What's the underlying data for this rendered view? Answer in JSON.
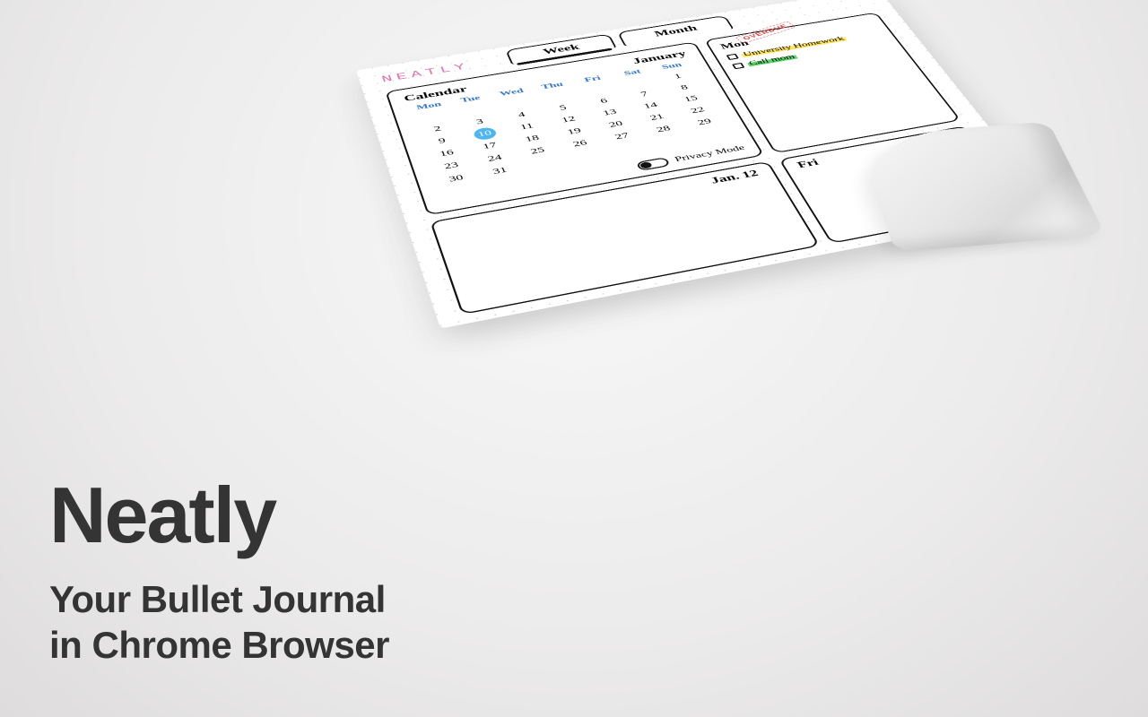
{
  "marketing": {
    "title": "Neatly",
    "subtitle_line1": "Your Bullet Journal",
    "subtitle_line2": "in Chrome Browser"
  },
  "logo": "NEATLY",
  "tabs": {
    "week": "Week",
    "month": "Month"
  },
  "calendar": {
    "title": "Calendar",
    "month": "January",
    "dow": [
      "Mon",
      "Tue",
      "Wed",
      "Thu",
      "Fri",
      "Sat",
      "Sun"
    ],
    "grid": [
      [
        "",
        "",
        "",
        "",
        "",
        "",
        "1"
      ],
      [
        "2",
        "3",
        "4",
        "5",
        "6",
        "7",
        "8"
      ],
      [
        "9",
        "10",
        "11",
        "12",
        "13",
        "14",
        "15"
      ],
      [
        "16",
        "17",
        "18",
        "19",
        "20",
        "21",
        "22"
      ],
      [
        "23",
        "24",
        "25",
        "26",
        "27",
        "28",
        "29"
      ],
      [
        "30",
        "31",
        "",
        "",
        "",
        "",
        ""
      ]
    ],
    "today": "10",
    "privacy_label": "Privacy Mode"
  },
  "tasks": {
    "day_label": "Mon",
    "overdue_stamp": "OVERDUE",
    "items": [
      {
        "text": "University Homework",
        "highlight": "yellow"
      },
      {
        "text": "Call mom",
        "highlight": "green"
      }
    ]
  },
  "bottom_panels": {
    "left_label": "Jan. 12",
    "right_label": "Fri",
    "add_label": "+"
  }
}
